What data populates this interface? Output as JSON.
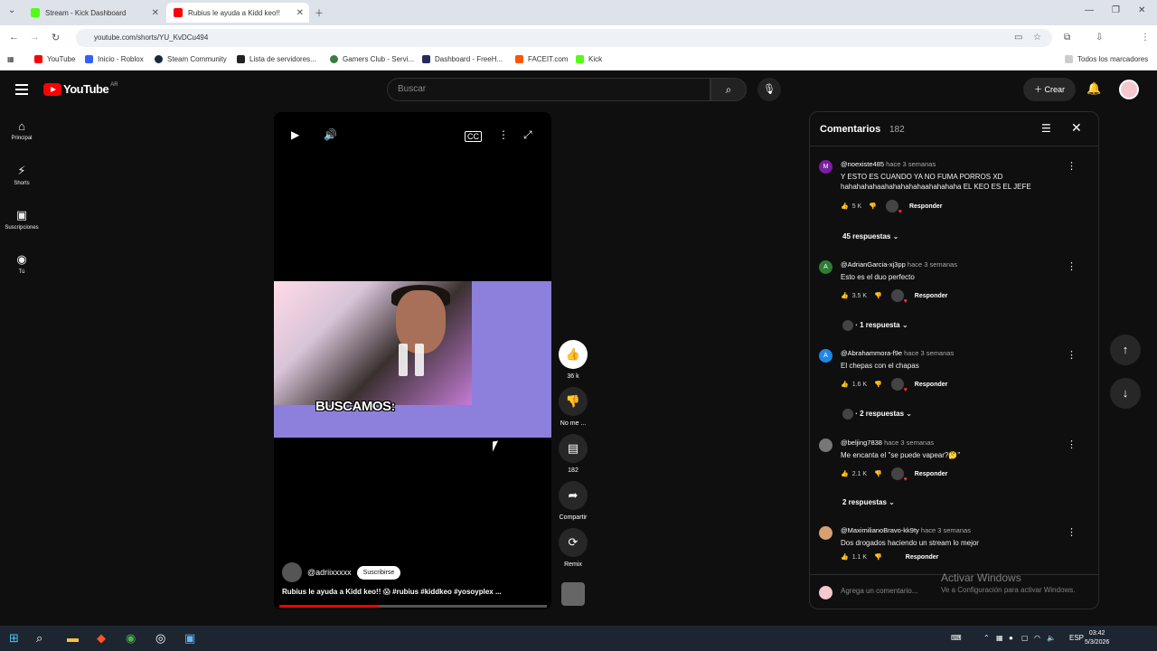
{
  "browser": {
    "tabs": [
      {
        "title": "Stream - Kick Dashboard",
        "color": "#53fc18"
      },
      {
        "title": "Rubius le ayuda a Kidd keo!!",
        "color": "#ff0000"
      }
    ],
    "url": "youtube.com/shorts/YU_KvDCu494",
    "bookmarks": [
      "YouTube",
      "Inicio - Roblox",
      "Steam Community",
      "Lista de servidores...",
      "Gamers Club - Servi...",
      "Dashboard - FreeH...",
      "FACEIT.com",
      "Kick"
    ],
    "bookmarks_folder": "Todos los marcadores"
  },
  "yt": {
    "logo": "YouTube",
    "country": "AR",
    "search_placeholder": "Buscar",
    "create_label": "Crear",
    "sidebar": [
      {
        "label": "Principal",
        "icon": "home-icon"
      },
      {
        "label": "Shorts",
        "icon": "shorts-icon"
      },
      {
        "label": "Suscripciones",
        "icon": "subscriptions-icon"
      },
      {
        "label": "Tú",
        "icon": "you-icon"
      }
    ]
  },
  "short": {
    "overlay_text": "BUSCAMOS:",
    "channel": "@adriixxxxx",
    "subscribe_label": "Suscribirse",
    "title": "Rubius le ayuda a Kidd keo!! 😱 #rubius #kiddkeo #yosoyplex ...",
    "progress": 0.37,
    "actions": {
      "likes": "36 k",
      "dislike_label": "No me ...",
      "comments": "182",
      "share_label": "Compartir",
      "remix_label": "Remix"
    }
  },
  "comments": {
    "title": "Comentarios",
    "count": "182",
    "add_placeholder": "Agrega un comentario...",
    "reply_label": "Responder",
    "items": [
      {
        "author": "@noexiste485",
        "time": "hace 3 semanas",
        "text": "Y ESTO ES CUANDO YA NO FUMA PORROS XD hahahahahaahahahahahaahahahaha EL  KEO ES EL JEFE",
        "likes": "5 K",
        "replies": "45 respuestas",
        "initial": "M",
        "color": "#7b1fa2"
      },
      {
        "author": "@AdrianGarcia-xj3pp",
        "time": "hace 3 semanas",
        "text": "Esto es el duo perfecto",
        "likes": "3.5 K",
        "replies": "· 1 respuesta",
        "initial": "A",
        "color": "#2e7d32"
      },
      {
        "author": "@Abrahammora-f9e",
        "time": "hace 3 semanas",
        "text": "El chepas  con el chapas",
        "likes": "1.6 K",
        "replies": "· 2 respuestas",
        "initial": "A",
        "color": "#1e88e5"
      },
      {
        "author": "@beljing7838",
        "time": "hace 3 semanas",
        "text": "Me encanta el \"se puede vapear?🤔\"",
        "likes": "2.1 K",
        "replies": "2 respuestas",
        "initial": "",
        "color": "#777777"
      },
      {
        "author": "@MaximilianoBravo-kk9ty",
        "time": "hace 3 semanas",
        "text": "Dos drogados haciendo un stream lo mejor",
        "likes": "1.1 K",
        "replies": "",
        "initial": "",
        "color": "#d8a070"
      }
    ]
  },
  "watermark": {
    "line1": "Activar Windows",
    "line2": "Ve a Configuración para activar Windows."
  },
  "taskbar": {
    "lang": "ESP",
    "time": "03:42",
    "date": "5/3/2026"
  }
}
